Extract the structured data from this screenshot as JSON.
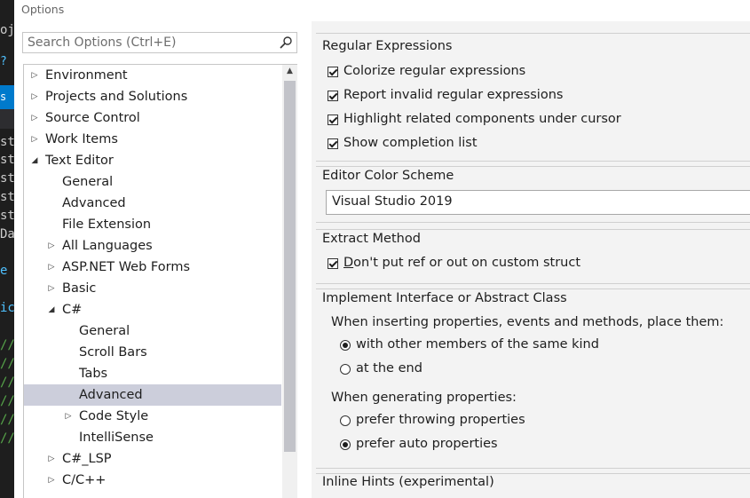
{
  "dialog": {
    "title": "Options"
  },
  "search": {
    "placeholder": "Search Options (Ctrl+E)"
  },
  "background_editor": {
    "lines": [
      "oj",
      "st",
      "st",
      "st",
      "st",
      "st",
      "Da",
      "e",
      "ic",
      "//",
      "//",
      "//",
      "//",
      "//",
      "//"
    ]
  },
  "tree": {
    "items": [
      {
        "label": "Environment",
        "arrow": "collapsed"
      },
      {
        "label": "Projects and Solutions",
        "arrow": "collapsed"
      },
      {
        "label": "Source Control",
        "arrow": "collapsed"
      },
      {
        "label": "Work Items",
        "arrow": "collapsed"
      },
      {
        "label": "Text Editor",
        "arrow": "expanded"
      },
      {
        "label": "General",
        "arrow": "none"
      },
      {
        "label": "Advanced",
        "arrow": "none"
      },
      {
        "label": "File Extension",
        "arrow": "none"
      },
      {
        "label": "All Languages",
        "arrow": "collapsed"
      },
      {
        "label": "ASP.NET Web Forms",
        "arrow": "collapsed"
      },
      {
        "label": "Basic",
        "arrow": "collapsed"
      },
      {
        "label": "C#",
        "arrow": "expanded"
      },
      {
        "label": "General",
        "arrow": "none"
      },
      {
        "label": "Scroll Bars",
        "arrow": "none"
      },
      {
        "label": "Tabs",
        "arrow": "none"
      },
      {
        "label": "Advanced",
        "arrow": "none",
        "selected": true
      },
      {
        "label": "Code Style",
        "arrow": "collapsed"
      },
      {
        "label": "IntelliSense",
        "arrow": "none"
      },
      {
        "label": "C#_LSP",
        "arrow": "collapsed"
      },
      {
        "label": "C/C++",
        "arrow": "collapsed"
      }
    ]
  },
  "regex": {
    "title": "Regular Expressions",
    "colorize": "Colorize regular expressions",
    "report": "Report invalid regular expressions",
    "highlight": "Highlight related components under cursor",
    "completion": "Show completion list"
  },
  "color_scheme": {
    "title": "Editor Color Scheme",
    "value": "Visual Studio 2019"
  },
  "extract": {
    "title": "Extract Method",
    "dont_key": "D",
    "dont_rest": "on't put ref or out on custom struct"
  },
  "implement": {
    "title": "Implement Interface or Abstract Class",
    "inserting_label": "When inserting properties, events and methods, place them:",
    "opt_same_kind": "with other members of the same kind",
    "opt_end": "at the end",
    "generating_label": "When generating properties:",
    "opt_throwing": "prefer throwing properties",
    "opt_auto": "prefer auto properties"
  },
  "inline_hints": {
    "title": "Inline Hints (experimental)"
  },
  "colors": {
    "selection": "#cccedb",
    "editor_bg": "#1e1e1e",
    "accent": "#007acc",
    "comment": "#57a64a"
  }
}
